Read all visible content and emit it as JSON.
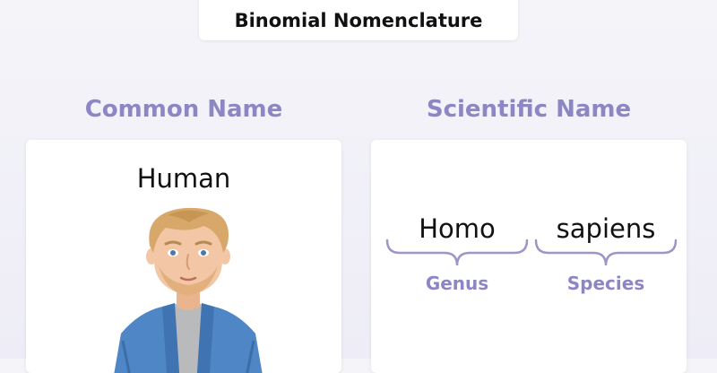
{
  "title": "Binomial Nomenclature",
  "common": {
    "heading": "Common Name",
    "name": "Human"
  },
  "scientific": {
    "heading": "Scientific Name",
    "genus": {
      "word": "Homo",
      "label": "Genus"
    },
    "species": {
      "word": "sapiens",
      "label": "Species"
    }
  },
  "colors": {
    "accent": "#8d86c4",
    "brace": "#9c97c9",
    "jacket": "#4f86c6",
    "shirt": "#b9babc",
    "hair": "#d8a86a",
    "skin": "#f3c7a5"
  }
}
